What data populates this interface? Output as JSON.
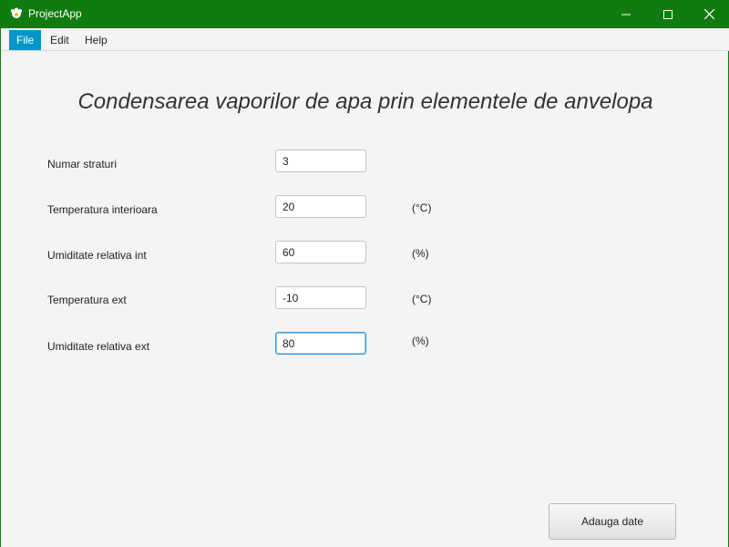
{
  "window": {
    "title": "ProjectApp",
    "accent_color": "#107c10",
    "icon": "java-cup-icon"
  },
  "menu": {
    "items": [
      {
        "label": "File",
        "active": true
      },
      {
        "label": "Edit",
        "active": false
      },
      {
        "label": "Help",
        "active": false
      }
    ],
    "active_color": "#0096c9"
  },
  "main": {
    "heading": "Condensarea vaporilor de apa prin elementele de anvelopa",
    "fields": [
      {
        "label": "Numar straturi",
        "value": "3",
        "unit": ""
      },
      {
        "label": "Temperatura interioara",
        "value": "20",
        "unit": "(°C)"
      },
      {
        "label": "Umiditate relativa int",
        "value": "60",
        "unit": "(%)"
      },
      {
        "label": "Temperatura ext",
        "value": "-10",
        "unit": "(°C)"
      },
      {
        "label": "Umiditate relativa ext",
        "value": "80",
        "unit": "(%)"
      }
    ],
    "submit_label": "Adauga date"
  }
}
